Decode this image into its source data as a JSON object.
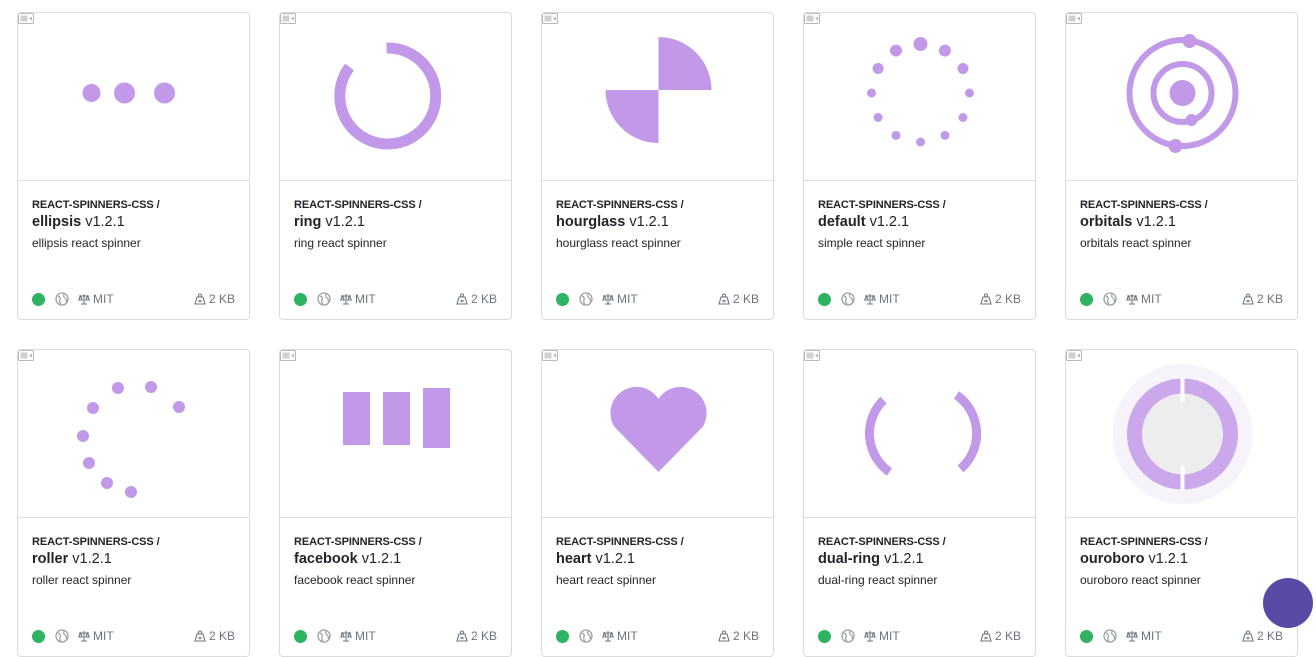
{
  "accent_color": "#c199e8",
  "status_color": "#2eb360",
  "cards": [
    {
      "scope": "REACT-SPINNERS-CSS /",
      "name": "ellipsis",
      "version": "v1.2.1",
      "description": "ellipsis react spinner",
      "license": "MIT",
      "size": "2 KB",
      "spinner": "ellipsis"
    },
    {
      "scope": "REACT-SPINNERS-CSS /",
      "name": "ring",
      "version": "v1.2.1",
      "description": "ring react spinner",
      "license": "MIT",
      "size": "2 KB",
      "spinner": "ring"
    },
    {
      "scope": "REACT-SPINNERS-CSS /",
      "name": "hourglass",
      "version": "v1.2.1",
      "description": "hourglass react spinner",
      "license": "MIT",
      "size": "2 KB",
      "spinner": "hourglass"
    },
    {
      "scope": "REACT-SPINNERS-CSS /",
      "name": "default",
      "version": "v1.2.1",
      "description": "simple react spinner",
      "license": "MIT",
      "size": "2 KB",
      "spinner": "default"
    },
    {
      "scope": "REACT-SPINNERS-CSS /",
      "name": "orbitals",
      "version": "v1.2.1",
      "description": "orbitals react spinner",
      "license": "MIT",
      "size": "2 KB",
      "spinner": "orbitals"
    },
    {
      "scope": "REACT-SPINNERS-CSS /",
      "name": "roller",
      "version": "v1.2.1",
      "description": "roller react spinner",
      "license": "MIT",
      "size": "2 KB",
      "spinner": "roller"
    },
    {
      "scope": "REACT-SPINNERS-CSS /",
      "name": "facebook",
      "version": "v1.2.1",
      "description": "facebook react spinner",
      "license": "MIT",
      "size": "2 KB",
      "spinner": "facebook"
    },
    {
      "scope": "REACT-SPINNERS-CSS /",
      "name": "heart",
      "version": "v1.2.1",
      "description": "heart react spinner",
      "license": "MIT",
      "size": "2 KB",
      "spinner": "heart"
    },
    {
      "scope": "REACT-SPINNERS-CSS /",
      "name": "dual-ring",
      "version": "v1.2.1",
      "description": "dual-ring react spinner",
      "license": "MIT",
      "size": "2 KB",
      "spinner": "dual-ring"
    },
    {
      "scope": "REACT-SPINNERS-CSS /",
      "name": "ouroboro",
      "version": "v1.2.1",
      "description": "ouroboro react spinner",
      "license": "MIT",
      "size": "2 KB",
      "spinner": "ouroboro"
    }
  ],
  "icons": {
    "preview": "video-icon",
    "status": "status-dot",
    "public": "globe-icon",
    "license": "scale-icon",
    "size": "weight-icon"
  }
}
